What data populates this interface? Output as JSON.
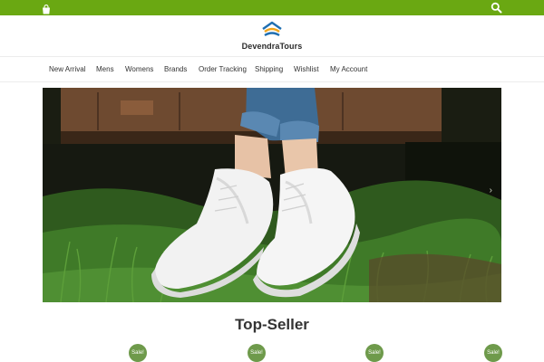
{
  "site": {
    "brand": "DevendraTours",
    "topbar_color": "#6aa812",
    "accent_sale_color": "#6e9a4b",
    "icons": {
      "cart": "shopping-bag-icon",
      "search": "search-icon",
      "logo": "logo-mark-icon",
      "next": "chevron-right-icon"
    }
  },
  "nav": {
    "items": [
      {
        "label": "New Arrival"
      },
      {
        "label": "Mens"
      },
      {
        "label": "Womens"
      },
      {
        "label": "Brands"
      },
      {
        "label": "Order Tracking"
      },
      {
        "label": "Shipping"
      },
      {
        "label": "Wishlist"
      },
      {
        "label": "My Account"
      }
    ]
  },
  "slider": {
    "next_glyph": "›"
  },
  "section": {
    "title": "Top-Seller"
  },
  "products": [
    {
      "badge": "Sale!"
    },
    {
      "badge": "Sale!"
    },
    {
      "badge": "Sale!"
    },
    {
      "badge": "Sale!"
    }
  ]
}
